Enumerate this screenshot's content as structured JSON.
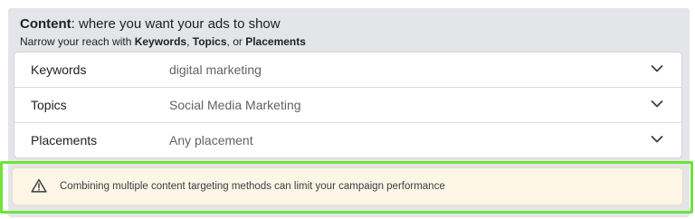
{
  "header": {
    "title_bold": "Content",
    "title_rest": ": where you want your ads to show",
    "subtitle_prefix": "Narrow your reach with ",
    "subtitle_keywords": "Keywords",
    "subtitle_sep1": ", ",
    "subtitle_topics": "Topics",
    "subtitle_sep2": ", or ",
    "subtitle_placements": "Placements"
  },
  "rows": [
    {
      "label": "Keywords",
      "value": "digital marketing",
      "icon": "chevron-down-icon"
    },
    {
      "label": "Topics",
      "value": "Social Media Marketing",
      "icon": "chevron-down-icon"
    },
    {
      "label": "Placements",
      "value": "Any placement",
      "icon": "chevron-down-icon"
    }
  ],
  "warning": {
    "icon": "warning-icon",
    "text": "Combining multiple content targeting methods can limit your campaign performance"
  },
  "colors": {
    "panel_bg": "#e4e5e8",
    "warning_bg": "#fdf5e6",
    "highlight_border": "#6fe337",
    "warning_icon": "#3c4043"
  }
}
